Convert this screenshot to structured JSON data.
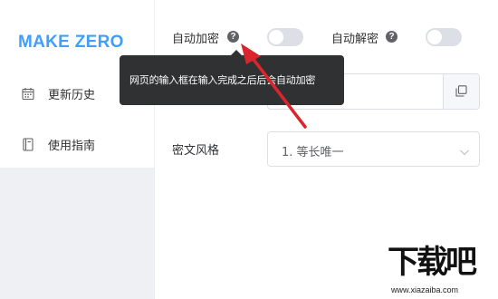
{
  "sidebar": {
    "logo": "MAKE ZERO",
    "items": [
      {
        "label": "更新历史",
        "icon": "calendar-icon"
      },
      {
        "label": "使用指南",
        "icon": "book-icon"
      }
    ]
  },
  "form": {
    "auto_encrypt_label": "自动加密",
    "auto_decrypt_label": "自动解密",
    "auto_encrypt_on": false,
    "auto_decrypt_on": false,
    "input": {
      "value": "",
      "placeholder": ""
    },
    "style_label": "密文风格",
    "style_selected": "1. 等长唯一"
  },
  "tooltip": {
    "text": "网页的输入框在输入完成之后后会自动加密"
  },
  "watermark": {
    "main": "下载吧",
    "url": "www.xiazaiba.com"
  },
  "colors": {
    "accent": "#409eff",
    "tooltip_bg": "#303133",
    "switch_off": "#dcdfe6",
    "annotation_arrow": "#d9262c"
  }
}
